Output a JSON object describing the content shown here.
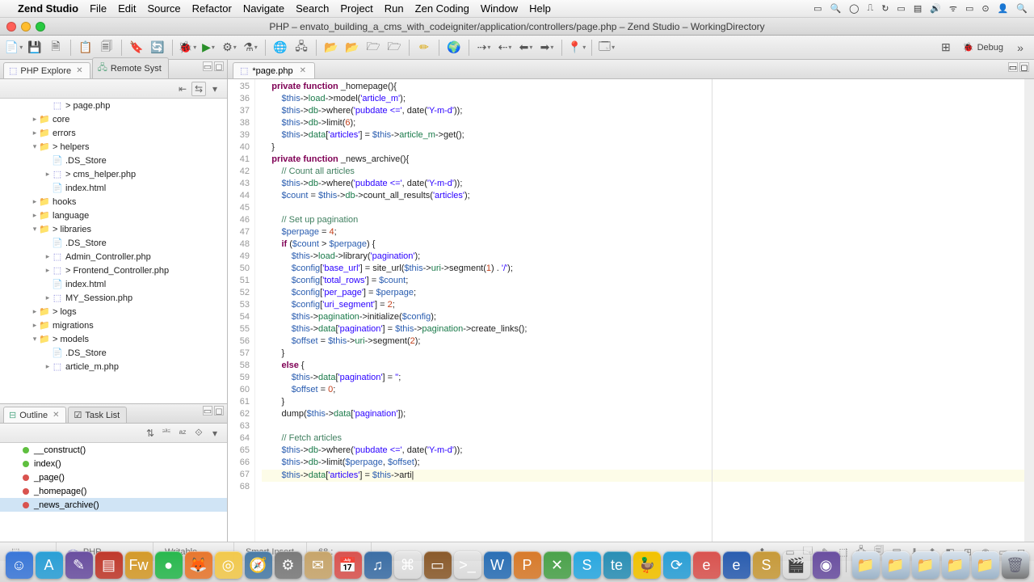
{
  "menubar": {
    "app_name": "Zend Studio",
    "items": [
      "File",
      "Edit",
      "Source",
      "Refactor",
      "Navigate",
      "Search",
      "Project",
      "Run",
      "Zen Coding",
      "Window",
      "Help"
    ]
  },
  "window": {
    "title": "PHP – envato_building_a_cms_with_codeigniter/application/controllers/page.php – Zend Studio – WorkingDirectory"
  },
  "perspective": {
    "debug_label": "Debug"
  },
  "left_views": {
    "explorer_tab": "PHP Explore",
    "remote_tab": "Remote Syst"
  },
  "tree": [
    {
      "depth": 3,
      "twisty": "",
      "icon": "php",
      "label": "> page.php"
    },
    {
      "depth": 2,
      "twisty": "▸",
      "icon": "folder",
      "label": "core"
    },
    {
      "depth": 2,
      "twisty": "▸",
      "icon": "folder",
      "label": "errors"
    },
    {
      "depth": 2,
      "twisty": "▾",
      "icon": "folder",
      "label": "> helpers"
    },
    {
      "depth": 3,
      "twisty": "",
      "icon": "file",
      "label": ".DS_Store"
    },
    {
      "depth": 3,
      "twisty": "▸",
      "icon": "php",
      "label": "> cms_helper.php"
    },
    {
      "depth": 3,
      "twisty": "",
      "icon": "file",
      "label": "index.html"
    },
    {
      "depth": 2,
      "twisty": "▸",
      "icon": "folder",
      "label": "hooks"
    },
    {
      "depth": 2,
      "twisty": "▸",
      "icon": "folder",
      "label": "language"
    },
    {
      "depth": 2,
      "twisty": "▾",
      "icon": "folder",
      "label": "> libraries"
    },
    {
      "depth": 3,
      "twisty": "",
      "icon": "file",
      "label": ".DS_Store"
    },
    {
      "depth": 3,
      "twisty": "▸",
      "icon": "php",
      "label": "Admin_Controller.php"
    },
    {
      "depth": 3,
      "twisty": "▸",
      "icon": "php",
      "label": "> Frontend_Controller.php"
    },
    {
      "depth": 3,
      "twisty": "",
      "icon": "file",
      "label": "index.html"
    },
    {
      "depth": 3,
      "twisty": "▸",
      "icon": "php",
      "label": "MY_Session.php"
    },
    {
      "depth": 2,
      "twisty": "▸",
      "icon": "folder",
      "label": "> logs"
    },
    {
      "depth": 2,
      "twisty": "▸",
      "icon": "folder",
      "label": "migrations"
    },
    {
      "depth": 2,
      "twisty": "▾",
      "icon": "folder",
      "label": "> models"
    },
    {
      "depth": 3,
      "twisty": "",
      "icon": "file",
      "label": ".DS_Store"
    },
    {
      "depth": 3,
      "twisty": "▸",
      "icon": "php",
      "label": "article_m.php"
    }
  ],
  "outline_tab": "Outline",
  "tasklist_tab": "Task List",
  "outline": [
    {
      "color": "green",
      "label": "__construct()"
    },
    {
      "color": "green",
      "label": "index()"
    },
    {
      "color": "red",
      "label": "_page()"
    },
    {
      "color": "red",
      "label": "_homepage()"
    },
    {
      "color": "red",
      "label": "_news_archive()",
      "sel": true
    }
  ],
  "editor": {
    "tab_label": "*page.php",
    "first_line": 35,
    "cursor_line": 68,
    "lines": [
      "    <kw>private</kw> <kw>function</kw> <fn>_homepage</fn>(){",
      "        <var>$this</var>-><prop>load</prop>-><fn>model</fn>(<str>'article_m'</str>);",
      "        <var>$this</var>-><prop>db</prop>-><fn>where</fn>(<str>'pubdate <='</str>, <fn>date</fn>(<str>'Y-m-d'</str>));",
      "        <var>$this</var>-><prop>db</prop>-><fn>limit</fn>(<num>6</num>);",
      "        <var>$this</var>-><prop>data</prop>[<str>'articles'</str>] = <var>$this</var>-><prop>article_m</prop>-><fn>get</fn>();",
      "    }",
      "",
      "    <kw>private</kw> <kw>function</kw> <fn>_news_archive</fn>(){",
      "        <cm>// Count all articles</cm>",
      "        <var>$this</var>-><prop>db</prop>-><fn>where</fn>(<str>'pubdate <='</str>, <fn>date</fn>(<str>'Y-m-d'</str>));",
      "        <var>$count</var> = <var>$this</var>-><prop>db</prop>-><fn>count_all_results</fn>(<str>'articles'</str>);",
      "        ",
      "        <cm>// Set up pagination</cm>",
      "        <var>$perpage</var> = <num>4</num>;",
      "        <kw>if</kw> (<var>$count</var> > <var>$perpage</var>) {",
      "            <var>$this</var>-><prop>load</prop>-><fn>library</fn>(<str>'pagination'</str>);",
      "            <var>$config</var>[<str>'base_url'</str>] = <fn>site_url</fn>(<var>$this</var>-><prop>uri</prop>-><fn>segment</fn>(<num>1</num>) . <str>'/'</str>);",
      "            <var>$config</var>[<str>'total_rows'</str>] = <var>$count</var>;",
      "            <var>$config</var>[<str>'per_page'</str>] = <var>$perpage</var>;",
      "            <var>$config</var>[<str>'uri_segment'</str>] = <num>2</num>;",
      "            <var>$this</var>-><prop>pagination</prop>-><fn>initialize</fn>(<var>$config</var>);",
      "            <var>$this</var>-><prop>data</prop>[<str>'pagination'</str>] = <var>$this</var>-><prop>pagination</prop>-><fn>create_links</fn>();",
      "            <var>$offset</var> = <var>$this</var>-><prop>uri</prop>-><fn>segment</fn>(<num>2</num>);",
      "        }",
      "        <kw>else</kw> {",
      "            <var>$this</var>-><prop>data</prop>[<str>'pagination'</str>] = <str>''</str>;",
      "            <var>$offset</var> = <num>0</num>;",
      "        }",
      "        <fn>dump</fn>(<var>$this</var>-><prop>data</prop>[<str>'pagination'</str>]);",
      "        ",
      "        <cm>// Fetch articles</cm>",
      "        <var>$this</var>-><prop>db</prop>-><fn>where</fn>(<str>'pubdate <='</str>, <fn>date</fn>(<str>'Y-m-d'</str>));",
      "        <var>$this</var>-><prop>db</prop>-><fn>limit</fn>(<var>$perpage</var>, <var>$offset</var>);",
      "        <var>$this</var>-><prop>data</prop>[<str>'articles'</str>] = <var>$this</var>->arti|"
    ]
  },
  "status": {
    "lang": "PHP",
    "writable": "Writable",
    "insert": "Smart Insert",
    "pos": "68 :"
  },
  "dock_apps": [
    {
      "c": "#3a77d8",
      "t": "☺"
    },
    {
      "c": "#2a9fd6",
      "t": "A"
    },
    {
      "c": "#6a4fa0",
      "t": "✎"
    },
    {
      "c": "#c0392b",
      "t": "▤"
    },
    {
      "c": "#d49a2a",
      "t": "Fw"
    },
    {
      "c": "#28b84e",
      "t": "●"
    },
    {
      "c": "#e8772e",
      "t": "🦊"
    },
    {
      "c": "#f2c94c",
      "t": "◎"
    },
    {
      "c": "#4a7ba6",
      "t": "🧭"
    },
    {
      "c": "#7a7a7a",
      "t": "⚙"
    },
    {
      "c": "#c7a56b",
      "t": "✉"
    },
    {
      "c": "#d9534f",
      "t": "📅"
    },
    {
      "c": "#3b6ea5",
      "t": "♫"
    },
    {
      "c": "#444",
      "t": "⌘"
    },
    {
      "c": "#8a5a2b",
      "t": "▭"
    },
    {
      "c": "#222",
      "t": ">_"
    },
    {
      "c": "#2a6fb5",
      "t": "W"
    },
    {
      "c": "#d87a2a",
      "t": "P"
    },
    {
      "c": "#4aa24a",
      "t": "✕"
    },
    {
      "c": "#2aa8e0",
      "t": "S"
    },
    {
      "c": "#2a8fb5",
      "t": "te"
    },
    {
      "c": "#f2c200",
      "t": "🦆"
    },
    {
      "c": "#2a9fd6",
      "t": "⟳"
    },
    {
      "c": "#d9534f",
      "t": "e"
    },
    {
      "c": "#2a5db0",
      "t": "e"
    },
    {
      "c": "#c79a3a",
      "t": "S"
    },
    {
      "c": "#555",
      "t": "🎬"
    },
    {
      "c": "#6a4fa0",
      "t": "◉"
    }
  ]
}
